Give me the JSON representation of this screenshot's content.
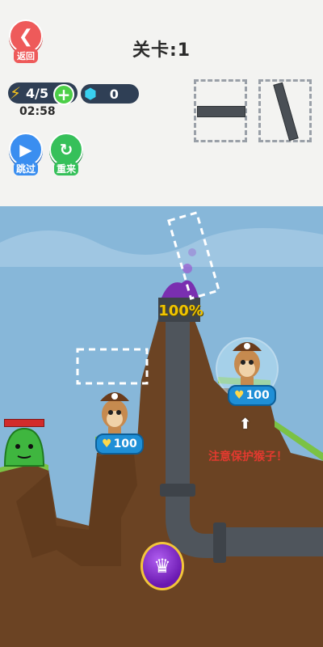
{
  "hud": {
    "back_label": "返回",
    "level_title": "关卡:1",
    "energy": "4/5",
    "timer": "02:58",
    "gems": "0",
    "skip_label": "跳过",
    "retry_label": "重来"
  },
  "scene": {
    "fill_percent_label": "100%",
    "monkey_left_hp": "100",
    "monkey_right_hp": "100",
    "warning": "注意保护猴子！",
    "enemy_hp_fraction": 1.0
  },
  "colors": {
    "sky": "#87b7d9",
    "dirt": "#6b4323",
    "grass": "#7bc244",
    "pipe": "#4f555c",
    "accent_red": "#e23a2f"
  },
  "icons": {
    "back": "back-arrow-icon",
    "energy": "lightning-icon",
    "gem": "gem-icon",
    "skip": "play-skip-icon",
    "retry": "retry-icon",
    "power": "crown-icon"
  }
}
